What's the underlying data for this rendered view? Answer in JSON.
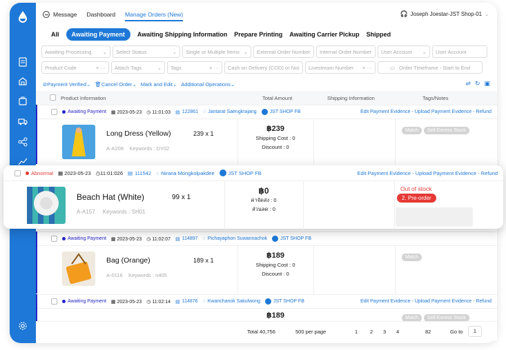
{
  "nav": {
    "message": "Message",
    "dashboard": "Dashboard",
    "manage_orders": "Manage Orders (New)",
    "user": "Joseph Joestar-JST Shop-01"
  },
  "status_tabs": [
    "All",
    "Awaiting Payment",
    "Awaiting Shipping Information",
    "Prepare Printing",
    "Awaiting Carrier Pickup",
    "Shipped"
  ],
  "filters": {
    "row1": [
      "Awaiting Processing",
      "Select Status",
      "Single or Multiple Items",
      "External Order Number",
      "Internal Order Number",
      "User Account",
      "User Account"
    ],
    "row2": [
      "Product Code",
      "Attach Tags",
      "Tags",
      "Cash on Delivery (COD) or Not",
      "Livestream Number",
      "Order Timeframe - Start to End"
    ]
  },
  "actions": {
    "payment_verified": "Payment Verified",
    "cancel_order": "Cancel Order",
    "mark_edit": "Mark and Edit",
    "additional": "Additional Operations"
  },
  "table_headers": {
    "product": "Product Information",
    "amount": "Total Amount",
    "shipping": "Shipping Information",
    "tags": "Tags/Notes"
  },
  "orders": [
    {
      "status": "Awaiting Payment",
      "date": "2023-05-23",
      "time": "11:01:03",
      "order_no": "122861",
      "customer": "Jantarat Saengkrajang",
      "shop": "JST SHOP FB",
      "links": "Edit Payment Evidence - Upload Payment Evidence - Refund",
      "product": "Long Dress (Yellow)",
      "qty": "239 x 1",
      "sku": "A-A208",
      "keywords": "Keywords : DY02",
      "total": "฿239",
      "shipping_cost": "Shipping Cost : 0",
      "discount": "Discount : 0",
      "tags": [
        "Match",
        "Sell Excess Stock"
      ]
    },
    {
      "status": "Awaiting Payment",
      "date": "2023-05-23",
      "time": "11:02:07",
      "order_no": "114897",
      "customer": "Pichayaphon Suwannachok",
      "shop": "JST SHOP FB",
      "links": "Edit Payment Evidence - Upload Payment Evidence - Refund",
      "product": "Bag (Orange)",
      "qty": "189 x 1",
      "sku": "A-0116",
      "keywords": "Keywords : n405",
      "total": "฿189",
      "shipping_cost": "Shipping Cost : 0",
      "discount": "Discount : 0",
      "tags": [
        "Match"
      ]
    },
    {
      "status": "Awaiting Payment",
      "date": "2023-05-23",
      "time": "11:02:14",
      "order_no": "114876",
      "customer": "Kwanchanok Sakulwong",
      "shop": "JST SHOP FB",
      "links": "Edit Payment Evidence - Upload Payment Evidence - Refund",
      "total": "฿189",
      "tags": [
        "Match",
        "Sell Excess Stock"
      ]
    }
  ],
  "popup_order": {
    "status": "Abnormal",
    "date": "2023-05-23",
    "time": "11:01:026",
    "order_no": "111542",
    "customer": "Nirana Mongkolpakdee",
    "shop": "JST SHOP FB",
    "links": "Edit Payment Evidence - Upload Payment Evidence - Refund",
    "product": "Beach Hat (White)",
    "qty": "99 x 1",
    "sku": "A-A157",
    "keywords": "Keywords : SH01",
    "total": "฿0",
    "shipping_cost": "ค่าจัดส่ง : 0",
    "discount": "ส่วนลด : 0",
    "out_of_stock": "Out of stock",
    "preorder": "2. Pre-order"
  },
  "footer": {
    "total": "Total 40,756",
    "per_page": "500 per page",
    "pages": [
      "1",
      "2",
      "3",
      "4"
    ],
    "last_page": "82",
    "goto": "Go to",
    "goto_value": "1"
  },
  "colors": {
    "brand": "#1e78d7",
    "status_blue": "#2424c8",
    "abnormal_red": "#e53935"
  }
}
